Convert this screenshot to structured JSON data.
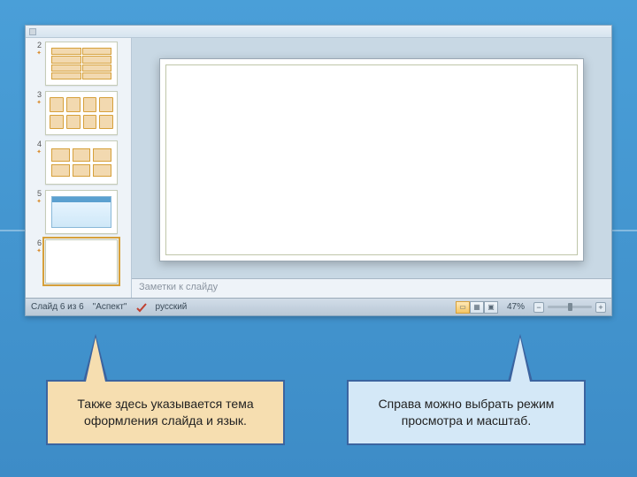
{
  "status": {
    "slide_counter": "Слайд 6 из 6",
    "theme": "\"Аспект\"",
    "language": "русский",
    "zoom": "47%"
  },
  "notes": {
    "placeholder": "Заметки к слайду"
  },
  "thumbs": [
    {
      "num": "2",
      "variant": "table"
    },
    {
      "num": "3",
      "variant": "flow"
    },
    {
      "num": "4",
      "variant": "boxes"
    },
    {
      "num": "5",
      "variant": "dialog"
    },
    {
      "num": "6",
      "variant": "blank",
      "selected": true
    }
  ],
  "view_buttons": [
    {
      "name": "normal-view-icon",
      "glyph": "▭",
      "active": true
    },
    {
      "name": "sorter-view-icon",
      "glyph": "▦",
      "active": false
    },
    {
      "name": "slideshow-view-icon",
      "glyph": "▣",
      "active": false
    }
  ],
  "zoom_buttons": {
    "minus": "−",
    "plus": "+"
  },
  "callouts": {
    "left": "Также здесь указывается тема оформления слайда и язык.",
    "right": "Справа можно выбрать режим просмотра и масштаб."
  },
  "icons": {
    "star": "✦"
  }
}
